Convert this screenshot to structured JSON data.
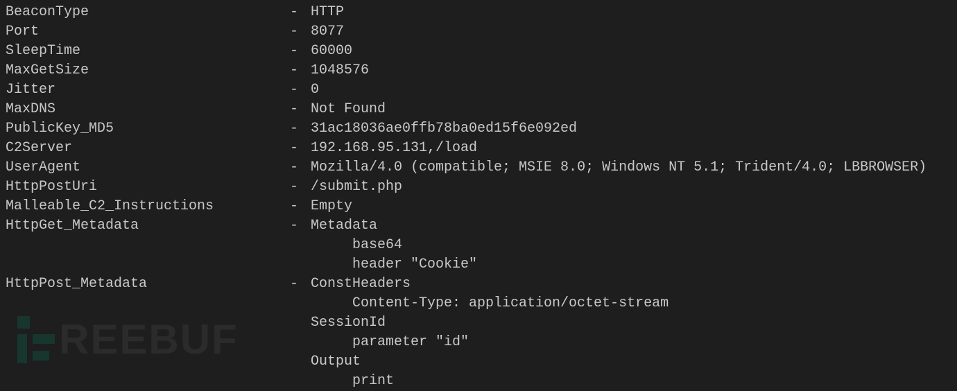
{
  "separator": "- ",
  "watermark_text": "REEBUF",
  "config": {
    "entries": [
      {
        "field": "BeaconType",
        "value": "HTTP"
      },
      {
        "field": "Port",
        "value": "8077"
      },
      {
        "field": "SleepTime",
        "value": "60000"
      },
      {
        "field": "MaxGetSize",
        "value": "1048576"
      },
      {
        "field": "Jitter",
        "value": "0"
      },
      {
        "field": "MaxDNS",
        "value": "Not Found"
      },
      {
        "field": "PublicKey_MD5",
        "value": "31ac18036ae0ffb78ba0ed15f6e092ed"
      },
      {
        "field": "C2Server",
        "value": "192.168.95.131,/load"
      },
      {
        "field": "UserAgent",
        "value": "Mozilla/4.0 (compatible; MSIE 8.0; Windows NT 5.1; Trident/4.0; LBBROWSER)"
      },
      {
        "field": "HttpPostUri",
        "value": "/submit.php"
      },
      {
        "field": "Malleable_C2_Instructions",
        "value": "Empty"
      },
      {
        "field": "HttpGet_Metadata",
        "value": "Metadata",
        "nested": [
          "base64",
          "header \"Cookie\""
        ]
      },
      {
        "field": "HttpPost_Metadata",
        "value": "ConstHeaders",
        "nested": [
          "Content-Type: application/octet-stream"
        ],
        "blocks": [
          {
            "label": "SessionId",
            "lines": [
              "parameter \"id\""
            ]
          },
          {
            "label": "Output",
            "lines": [
              "print"
            ]
          }
        ]
      }
    ]
  }
}
